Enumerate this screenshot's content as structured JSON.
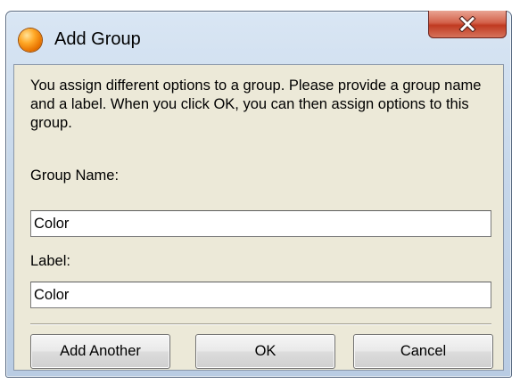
{
  "window": {
    "title": "Add Group",
    "app_icon": "orange-orb-icon",
    "close_icon": "close-icon"
  },
  "dialog": {
    "description": "You assign different options to a group. Please provide a group name and a label. When you click OK, you can then assign options to this group.",
    "group_name": {
      "label": "Group Name:",
      "value": "Color"
    },
    "label_field": {
      "label": "Label:",
      "value": "Color"
    }
  },
  "buttons": {
    "add_another": "Add Another",
    "ok": "OK",
    "cancel": "Cancel"
  },
  "colors": {
    "dialog_background": "#ece9d8",
    "close_button": "#c03a21"
  }
}
